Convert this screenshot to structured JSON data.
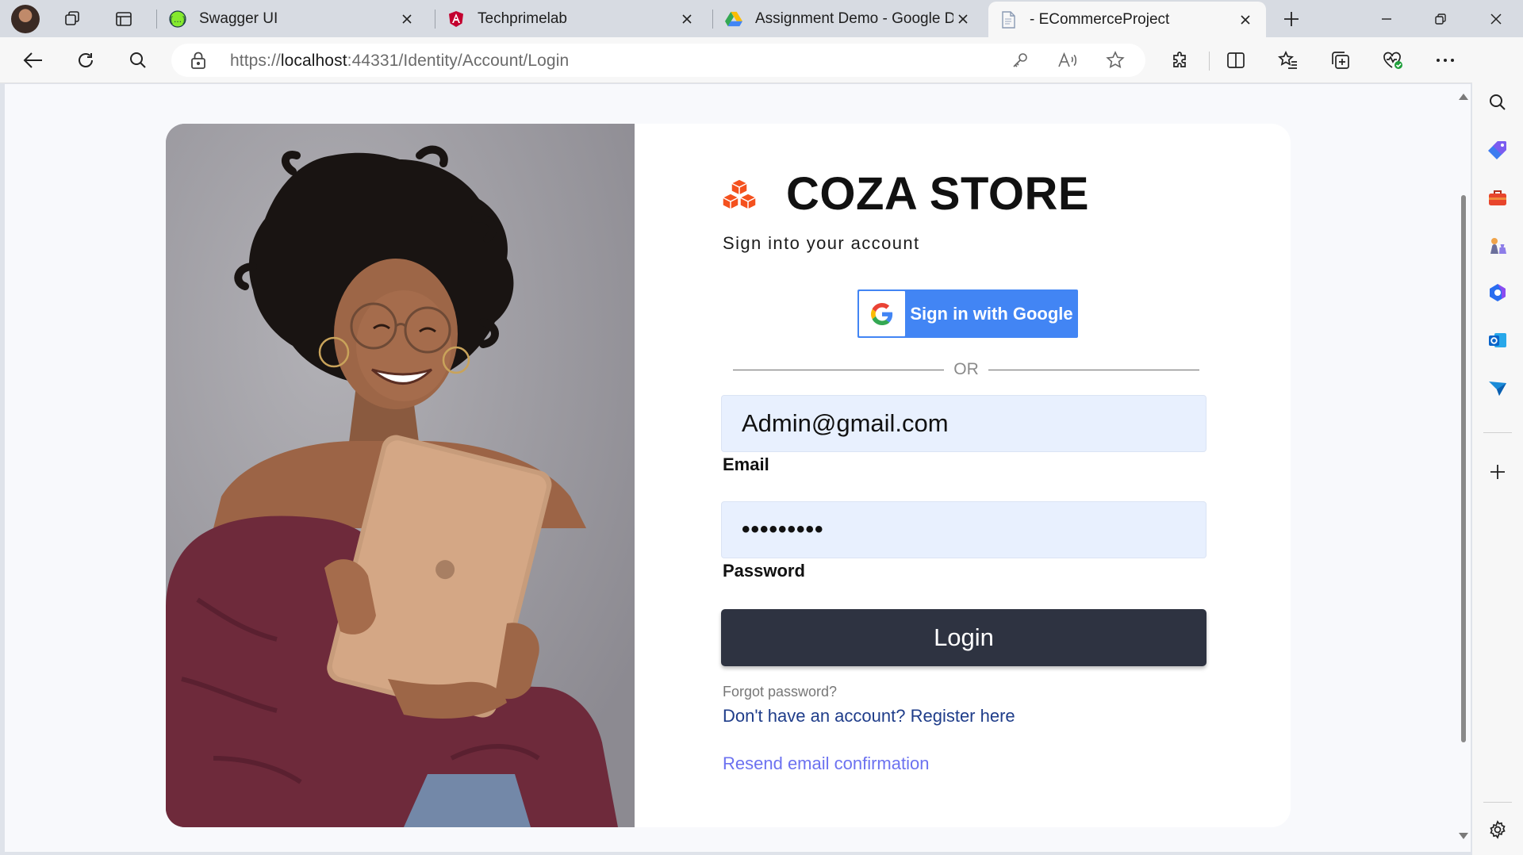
{
  "browser": {
    "tabs": [
      {
        "label": "Swagger UI",
        "icon": "swagger-icon"
      },
      {
        "label": "Techprimelab",
        "icon": "angular-icon"
      },
      {
        "label": "Assignment Demo - Google Dri",
        "icon": "google-drive-icon"
      },
      {
        "label": "- ECommerceProject",
        "icon": "page-icon",
        "active": true
      }
    ],
    "url": {
      "scheme": "https://",
      "host": "localhost",
      "rest": ":44331/Identity/Account/Login"
    }
  },
  "page": {
    "brand": "COZA STORE",
    "subtitle": "Sign into your account",
    "google_button": "Sign in with Google",
    "or_text": "OR",
    "email": {
      "value": "Admin@gmail.com",
      "label": "Email"
    },
    "password": {
      "value": "•••••••••",
      "label": "Password"
    },
    "login_button": "Login",
    "forgot_link": "Forgot password?",
    "register_link": "Don't have an account? Register here",
    "resend_link": "Resend email confirmation"
  },
  "colors": {
    "accent": "#2e3341",
    "google_blue": "#4285f4",
    "logo_orange": "#f4511e",
    "field_bg": "#e8f0fe",
    "resend_link": "#6c72f0"
  }
}
